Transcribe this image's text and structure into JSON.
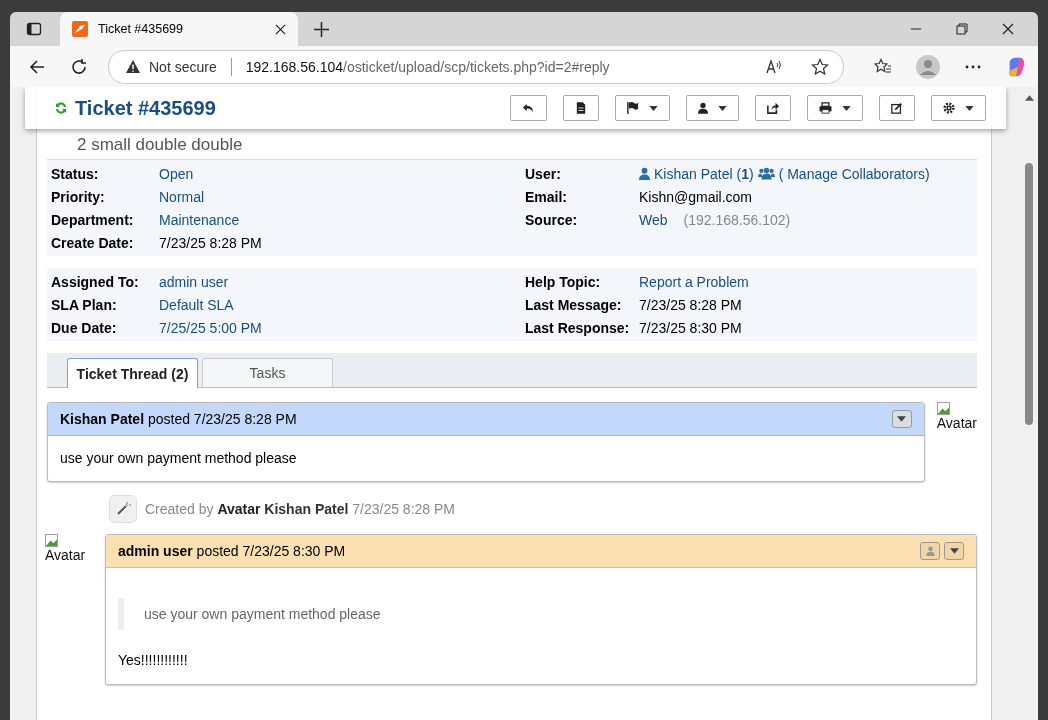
{
  "browser": {
    "tab_title": "Ticket #435699",
    "security": "Not secure",
    "url_host": "192.168.56.104",
    "url_path": "/osticket/upload/scp/tickets.php?id=2#reply"
  },
  "ticket": {
    "title": "Ticket #435699",
    "subject": "2 small double double"
  },
  "toolbar": [
    {
      "dropdown": false
    },
    {
      "dropdown": false
    },
    {
      "dropdown": true
    },
    {
      "dropdown": true
    },
    {
      "dropdown": false
    },
    {
      "dropdown": true
    },
    {
      "dropdown": false
    },
    {
      "dropdown": true
    }
  ],
  "info_blocks": [
    {
      "left": [
        {
          "label": "Status:",
          "value": "Open",
          "kind": "link"
        },
        {
          "label": "Priority:",
          "value": "Normal",
          "kind": "link"
        },
        {
          "label": "Department:",
          "value": "Maintenance",
          "kind": "link"
        },
        {
          "label": "Create Date:",
          "value": "7/23/25 8:28 PM",
          "kind": "plain"
        }
      ],
      "right": [
        {
          "label": "User:",
          "kind": "user",
          "value": "Kishan Patel (**1**)",
          "extra": "( Manage Collaborators)"
        },
        {
          "label": "Email:",
          "value": "Kishn@gmail.com",
          "kind": "plain"
        },
        {
          "label": "Source:",
          "value": "Web",
          "kind": "link",
          "note": "(192.168.56.102)"
        }
      ]
    },
    {
      "left": [
        {
          "label": "Assigned To:",
          "value": "admin user",
          "kind": "link"
        },
        {
          "label": "SLA Plan:",
          "value": "Default SLA",
          "kind": "link"
        },
        {
          "label": "Due Date:",
          "value": "7/25/25 5:00 PM",
          "kind": "link"
        }
      ],
      "right": [
        {
          "label": "Help Topic:",
          "value": "Report a Problem",
          "kind": "link"
        },
        {
          "label": "Last Message:",
          "value": "7/23/25 8:28 PM",
          "kind": "plain"
        },
        {
          "label": "Last Response:",
          "value": "7/23/25 8:30 PM",
          "kind": "plain"
        }
      ]
    }
  ],
  "tabs": [
    {
      "label": "Ticket Thread (2)",
      "selected": true
    },
    {
      "label": "Tasks",
      "selected": false
    }
  ],
  "thread": [
    {
      "kind": "message",
      "author": "Kishan Patel",
      "verb": "posted",
      "time": "7/23/25 8:28 PM",
      "avatar": "Avatar",
      "body": "use your own payment method please"
    },
    {
      "kind": "event",
      "prefix": "Created by",
      "avatar": "Avatar",
      "author": "Kishan Patel",
      "time": "7/23/25 8:28 PM"
    },
    {
      "kind": "response",
      "author": "admin user",
      "verb": "posted",
      "time": "7/23/25 8:30 PM",
      "avatar": "Avatar",
      "quote": "use your own payment method please",
      "body": "Yes!!!!!!!!!!!!"
    }
  ]
}
